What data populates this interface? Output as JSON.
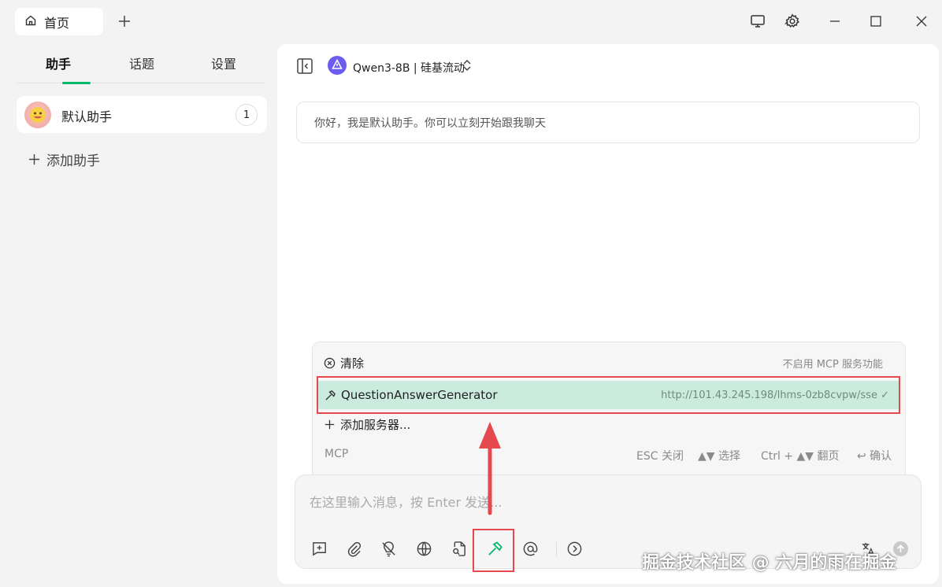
{
  "window": {
    "tab_label": "首页",
    "icons": [
      "home-icon",
      "plus-icon",
      "monitor-icon",
      "gear-icon",
      "minimize-icon",
      "maximize-icon",
      "close-icon"
    ]
  },
  "sidebar": {
    "tabs": [
      {
        "label": "助手",
        "active": true
      },
      {
        "label": "话题",
        "active": false
      },
      {
        "label": "设置",
        "active": false
      }
    ],
    "assistant": {
      "name": "默认助手",
      "count": "1"
    },
    "add_label": "添加助手"
  },
  "main": {
    "model_label": "Qwen3-8B | 硅基流动",
    "greeting": "你好，我是默认助手。你可以立刻开始跟我聊天"
  },
  "mcp": {
    "clear_label": "清除",
    "clear_hint": "不启用 MCP 服务功能",
    "server_name": "QuestionAnswerGenerator",
    "server_url": "http://101.43.245.198/lhms-0zb8cvpw/sse",
    "add_server_label": "添加服务器...",
    "footer": {
      "title": "MCP",
      "esc": "ESC 关闭",
      "select": "▲▼ 选择",
      "page": "Ctrl + ▲▼ 翻页",
      "confirm": "↩ 确认"
    }
  },
  "input": {
    "placeholder": "在这里输入消息，按 Enter 发送..."
  },
  "watermark": "掘金技术社区 @ 六月的雨在掘金",
  "colors": {
    "accent": "#00b96b",
    "highlight_red": "#e5484d",
    "selected_row": "#ccebdf"
  }
}
